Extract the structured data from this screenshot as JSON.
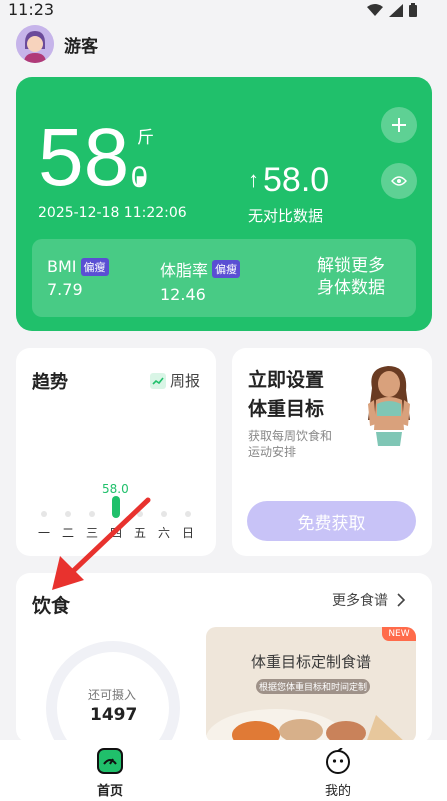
{
  "status_bar": {
    "time": "11:23"
  },
  "user": {
    "name": "游客"
  },
  "weight_card": {
    "weight_int": "58.",
    "weight_dec": "0",
    "unit": "斤",
    "datetime": "2025-12-18 11:22:06",
    "diff_arrow": "↑",
    "diff_value": "58.0",
    "diff_label": "无对比数据",
    "bmi_label": "BMI",
    "bmi_badge": "偏瘦",
    "bmi_value": "7.79",
    "bodyfat_label": "体脂率",
    "bodyfat_badge": "偏瘦",
    "bodyfat_value": "12.46",
    "unlock_line1": "解锁更多",
    "unlock_line2": "身体数据",
    "accent_color": "#20c06b"
  },
  "trend": {
    "title": "趋势",
    "weekly_label": "周报",
    "chart_data": {
      "type": "bar",
      "categories": [
        "一",
        "二",
        "三",
        "四",
        "五",
        "六",
        "日"
      ],
      "values": [
        null,
        null,
        null,
        58.0,
        null,
        null,
        null
      ],
      "data_label": "58.0"
    }
  },
  "goal": {
    "title_line1": "立即设置",
    "title_line2": "体重目标",
    "sub_line1": "获取每周饮食和",
    "sub_line2": "运动安排",
    "button_label": "免费获取"
  },
  "diet": {
    "title": "饮食",
    "more_label": "更多食谱",
    "ring_label": "还可摄入",
    "ring_value": "1497",
    "banner_title": "体重目标定制食谱",
    "banner_sub": "根据您体重目标和时间定制",
    "new_badge": "NEW"
  },
  "tabs": [
    {
      "label": "首页"
    },
    {
      "label": "我的"
    }
  ]
}
